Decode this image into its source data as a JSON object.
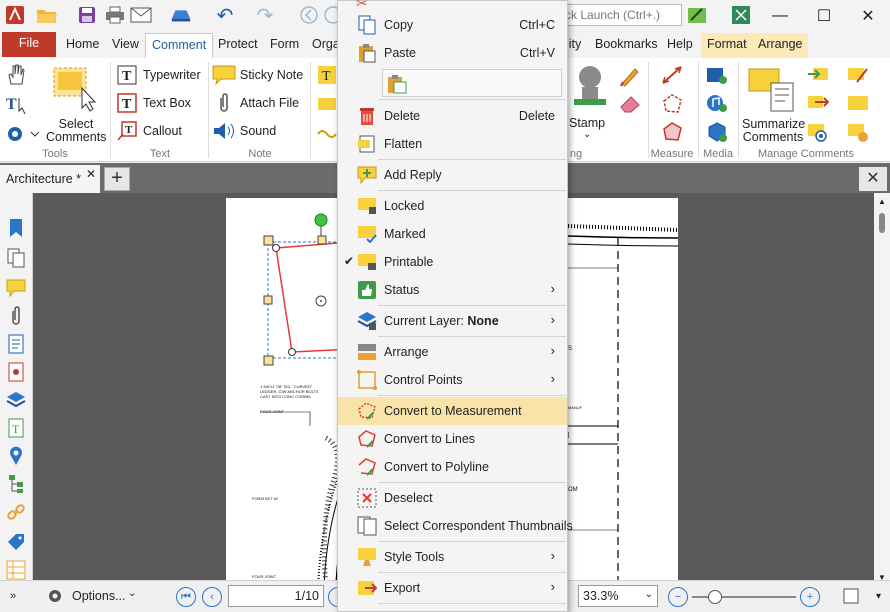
{
  "quick_access": {
    "search_placeholder": "ck Launch (Ctrl+.)"
  },
  "window": {
    "minimize": "—",
    "maximize": "☐",
    "close": "✕"
  },
  "ribbon_tabs": [
    {
      "label": "File"
    },
    {
      "label": "Home"
    },
    {
      "label": "View"
    },
    {
      "label": "Comment"
    },
    {
      "label": "Protect"
    },
    {
      "label": "Form"
    },
    {
      "label": "Orga"
    },
    {
      "label": "lity"
    },
    {
      "label": "Bookmarks"
    },
    {
      "label": "Help"
    },
    {
      "label": "Format"
    },
    {
      "label": "Arrange"
    }
  ],
  "ribbon": {
    "tools": {
      "select_comments": "Select Comments",
      "group": "Tools"
    },
    "text": {
      "typewriter": "Typewriter",
      "text_box": "Text Box",
      "callout": "Callout",
      "group": "Text"
    },
    "note": {
      "sticky_note": "Sticky Note",
      "attach_file": "Attach File",
      "sound": "Sound",
      "group": "Note"
    },
    "stamp": {
      "label": "Stamp",
      "group_fragment": "ng"
    },
    "measure": {
      "group": "Measure"
    },
    "media": {
      "group": "Media"
    },
    "manage": {
      "summarize": "Summarize Comments",
      "group": "Manage Comments"
    }
  },
  "doc_tab": {
    "title": "Architecture *"
  },
  "drawing_text": {
    "note1": "1 5/8\"x1 7/8\" SCL \"CURVED\" LEDGER, CIW ANCHOR BOLTS CAST INTO CONC CORBEL",
    "note2": "FOUR JOINT",
    "note3": "FORM SET #2",
    "note4": "FOUR JOINT",
    "right1": "S",
    "right2": "MANUF",
    "right3": "OM"
  },
  "status": {
    "options": "Options...",
    "page": "1/10",
    "zoom": "33.3%"
  },
  "context_menu": {
    "copy": {
      "label": "Copy",
      "shortcut": "Ctrl+C"
    },
    "paste": {
      "label": "Paste",
      "shortcut": "Ctrl+V"
    },
    "delete": {
      "label": "Delete",
      "shortcut": "Delete"
    },
    "flatten": "Flatten",
    "add_reply": "Add Reply",
    "locked": "Locked",
    "marked": "Marked",
    "printable": "Printable",
    "status": "Status",
    "current_layer": "Current Layer:",
    "current_layer_value": "None",
    "arrange": "Arrange",
    "control_points": "Control Points",
    "convert_measurement": "Convert to Measurement",
    "convert_lines": "Convert to Lines",
    "convert_polyline": "Convert to Polyline",
    "deselect": "Deselect",
    "select_thumbnails": "Select Correspondent Thumbnails",
    "style_tools": "Style Tools",
    "export": "Export"
  },
  "colors": {
    "file_tab": "#c0392b",
    "highlight": "#f8e3a8",
    "accent": "#2a75c9",
    "selection": "#e53935"
  }
}
